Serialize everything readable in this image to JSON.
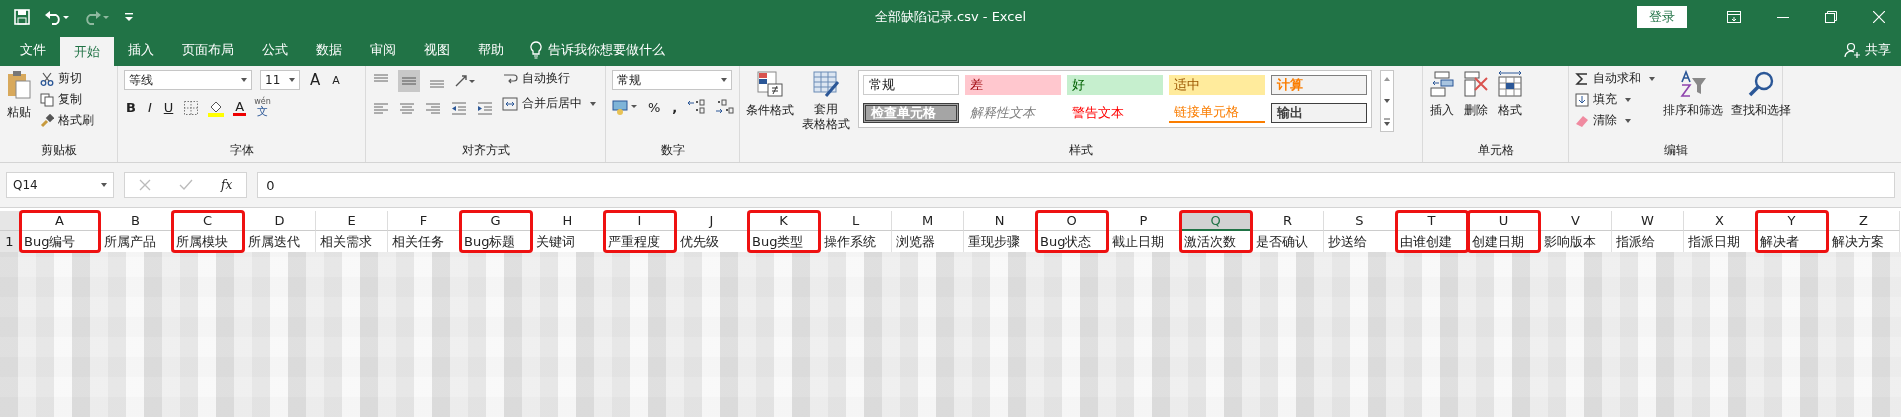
{
  "window": {
    "title": "全部缺陷记录.csv  -  Excel",
    "login": "登录"
  },
  "tabs": [
    {
      "label": "文件",
      "selected": false
    },
    {
      "label": "开始",
      "selected": true
    },
    {
      "label": "插入",
      "selected": false
    },
    {
      "label": "页面布局",
      "selected": false
    },
    {
      "label": "公式",
      "selected": false
    },
    {
      "label": "数据",
      "selected": false
    },
    {
      "label": "审阅",
      "selected": false
    },
    {
      "label": "视图",
      "selected": false
    },
    {
      "label": "帮助",
      "selected": false
    }
  ],
  "tell_me": "告诉我你想要做什么",
  "share": "共享",
  "ribbon": {
    "clipboard": {
      "label": "剪贴板",
      "paste": "粘贴",
      "cut": "剪切",
      "copy": "复制",
      "format_painter": "格式刷"
    },
    "font": {
      "label": "字体",
      "font_name": "等线",
      "font_size": "11",
      "grow": "A",
      "shrink": "A",
      "bold": "B",
      "italic": "I",
      "underline": "U",
      "font_color": "A",
      "phonetic_top": "wén",
      "phonetic": "文"
    },
    "alignment": {
      "label": "对齐方式",
      "wrap": "自动换行",
      "merge": "合并后居中"
    },
    "number": {
      "label": "数字",
      "format": "常规",
      "percent": "%",
      "comma": ","
    },
    "styles": {
      "label": "样式",
      "conditional": "条件格式",
      "table_format": [
        "套用",
        "表格格式"
      ],
      "cells": [
        {
          "label": "常规",
          "kind": "normal"
        },
        {
          "label": "差",
          "kind": "bad"
        },
        {
          "label": "好",
          "kind": "good"
        },
        {
          "label": "适中",
          "kind": "neutral"
        },
        {
          "label": "计算",
          "kind": "calculation"
        },
        {
          "label": "检查单元格",
          "kind": "check"
        },
        {
          "label": "解释性文本",
          "kind": "explanatory"
        },
        {
          "label": "警告文本",
          "kind": "warning"
        },
        {
          "label": "链接单元格",
          "kind": "linked"
        },
        {
          "label": "输出",
          "kind": "output"
        }
      ]
    },
    "cells": {
      "label": "单元格",
      "insert": "插入",
      "delete": "删除",
      "format": "格式"
    },
    "editing": {
      "label": "编辑",
      "autosum": "自动求和",
      "fill": "填充",
      "clear": "清除",
      "sort": "排序和筛选",
      "find": "查找和选择"
    }
  },
  "formula_bar": {
    "name_box": "Q14",
    "fx": "fx",
    "value": "0"
  },
  "sheet": {
    "row_number": "1",
    "columns": [
      {
        "letter": "A",
        "header": "Bug编号",
        "highlighted": true,
        "selected": false
      },
      {
        "letter": "B",
        "header": "所属产品",
        "highlighted": false,
        "selected": false
      },
      {
        "letter": "C",
        "header": "所属模块",
        "highlighted": true,
        "selected": false
      },
      {
        "letter": "D",
        "header": "所属迭代",
        "highlighted": false,
        "selected": false
      },
      {
        "letter": "E",
        "header": "相关需求",
        "highlighted": false,
        "selected": false
      },
      {
        "letter": "F",
        "header": "相关任务",
        "highlighted": false,
        "selected": false
      },
      {
        "letter": "G",
        "header": "Bug标题",
        "highlighted": true,
        "selected": false
      },
      {
        "letter": "H",
        "header": "关键词",
        "highlighted": false,
        "selected": false
      },
      {
        "letter": "I",
        "header": "严重程度",
        "highlighted": true,
        "selected": false
      },
      {
        "letter": "J",
        "header": "优先级",
        "highlighted": false,
        "selected": false
      },
      {
        "letter": "K",
        "header": "Bug类型",
        "highlighted": true,
        "selected": false
      },
      {
        "letter": "L",
        "header": "操作系统",
        "highlighted": false,
        "selected": false
      },
      {
        "letter": "M",
        "header": "浏览器",
        "highlighted": false,
        "selected": false
      },
      {
        "letter": "N",
        "header": "重现步骤",
        "highlighted": false,
        "selected": false
      },
      {
        "letter": "O",
        "header": "Bug状态",
        "highlighted": true,
        "selected": false
      },
      {
        "letter": "P",
        "header": "截止日期",
        "highlighted": false,
        "selected": false
      },
      {
        "letter": "Q",
        "header": "激活次数",
        "highlighted": true,
        "selected": true
      },
      {
        "letter": "R",
        "header": "是否确认",
        "highlighted": false,
        "selected": false
      },
      {
        "letter": "S",
        "header": "抄送给",
        "highlighted": false,
        "selected": false
      },
      {
        "letter": "T",
        "header": "由谁创建",
        "highlighted": true,
        "selected": false
      },
      {
        "letter": "U",
        "header": "创建日期",
        "highlighted": true,
        "selected": false
      },
      {
        "letter": "V",
        "header": "影响版本",
        "highlighted": false,
        "selected": false
      },
      {
        "letter": "W",
        "header": "指派给",
        "highlighted": false,
        "selected": false
      },
      {
        "letter": "X",
        "header": "指派日期",
        "highlighted": false,
        "selected": false
      },
      {
        "letter": "Y",
        "header": "解决者",
        "highlighted": true,
        "selected": false
      },
      {
        "letter": "Z",
        "header": "解决方案",
        "highlighted": false,
        "selected": false
      }
    ]
  }
}
